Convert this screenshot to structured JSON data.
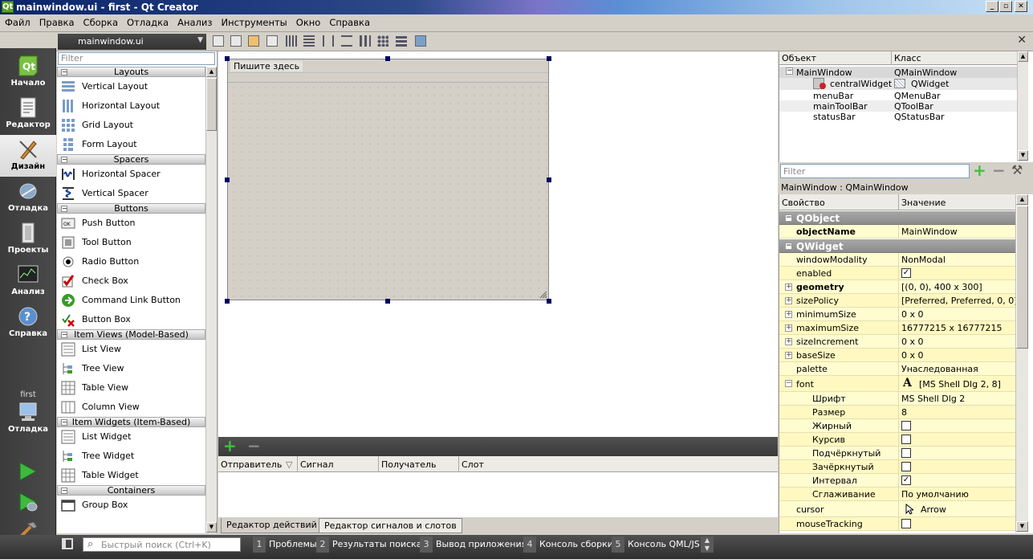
{
  "window": {
    "title": "mainwindow.ui - first - Qt Creator"
  },
  "menu": [
    "Файл",
    "Правка",
    "Сборка",
    "Отладка",
    "Анализ",
    "Инструменты",
    "Окно",
    "Справка"
  ],
  "modes": [
    {
      "label": "Начало",
      "icon": "qt-logo-icon"
    },
    {
      "label": "Редактор",
      "icon": "editor-icon"
    },
    {
      "label": "Дизайн",
      "icon": "design-icon"
    },
    {
      "label": "Отладка",
      "icon": "debug-icon"
    },
    {
      "label": "Проекты",
      "icon": "projects-icon"
    },
    {
      "label": "Анализ",
      "icon": "analyze-icon"
    },
    {
      "label": "Справка",
      "icon": "help-icon"
    }
  ],
  "target": {
    "project": "first",
    "label": "Отладка"
  },
  "editor": {
    "file": "mainwindow.ui"
  },
  "widgetbox": {
    "filter_placeholder": "Filter",
    "categories": [
      {
        "name": "Layouts",
        "items": [
          "Vertical Layout",
          "Horizontal Layout",
          "Grid Layout",
          "Form Layout"
        ]
      },
      {
        "name": "Spacers",
        "items": [
          "Horizontal Spacer",
          "Vertical Spacer"
        ]
      },
      {
        "name": "Buttons",
        "items": [
          "Push Button",
          "Tool Button",
          "Radio Button",
          "Check Box",
          "Command Link Button",
          "Button Box"
        ]
      },
      {
        "name": "Item Views (Model-Based)",
        "items": [
          "List View",
          "Tree View",
          "Table View",
          "Column View"
        ]
      },
      {
        "name": "Item Widgets (Item-Based)",
        "items": [
          "List Widget",
          "Tree Widget",
          "Table Widget"
        ]
      },
      {
        "name": "Containers",
        "items": [
          "Group Box"
        ]
      }
    ]
  },
  "form": {
    "menu_placeholder": "Пишите здесь"
  },
  "signals": {
    "columns": [
      "Отправитель",
      "Сигнал",
      "Получатель",
      "Слот"
    ],
    "tabs": [
      "Редактор действий",
      "Редактор сигналов и слотов"
    ]
  },
  "object_inspector": {
    "columns": [
      "Объект",
      "Класс"
    ],
    "rows": [
      {
        "object": "MainWindow",
        "class": "QMainWindow"
      },
      {
        "object": "centralWidget",
        "class": "QWidget"
      },
      {
        "object": "menuBar",
        "class": "QMenuBar"
      },
      {
        "object": "mainToolBar",
        "class": "QToolBar"
      },
      {
        "object": "statusBar",
        "class": "QStatusBar"
      }
    ]
  },
  "property_editor": {
    "filter_placeholder": "Filter",
    "class_label": "MainWindow : QMainWindow",
    "columns": [
      "Свойство",
      "Значение"
    ],
    "groups": {
      "qobject": "QObject",
      "qwidget": "QWidget"
    },
    "props": {
      "objectName": {
        "name": "objectName",
        "value": "MainWindow"
      },
      "windowModality": {
        "name": "windowModality",
        "value": "NonModal"
      },
      "enabled": {
        "name": "enabled",
        "checked": true
      },
      "geometry": {
        "name": "geometry",
        "value": "[(0, 0), 400 x 300]"
      },
      "sizePolicy": {
        "name": "sizePolicy",
        "value": "[Preferred, Preferred, 0, 0]"
      },
      "minimumSize": {
        "name": "minimumSize",
        "value": "0 x 0"
      },
      "maximumSize": {
        "name": "maximumSize",
        "value": "16777215 x 16777215"
      },
      "sizeIncrement": {
        "name": "sizeIncrement",
        "value": "0 x 0"
      },
      "baseSize": {
        "name": "baseSize",
        "value": "0 x 0"
      },
      "palette": {
        "name": "palette",
        "value": "Унаследованная"
      },
      "font": {
        "name": "font",
        "value": "[MS Shell Dlg 2, 8]"
      },
      "family": {
        "name": "Шрифт",
        "value": "MS Shell Dlg 2"
      },
      "size": {
        "name": "Размер",
        "value": "8"
      },
      "bold": {
        "name": "Жирный",
        "checked": false
      },
      "italic": {
        "name": "Курсив",
        "checked": false
      },
      "underline": {
        "name": "Подчёркнутый",
        "checked": false
      },
      "strikeout": {
        "name": "Зачёркнутый",
        "checked": false
      },
      "kerning": {
        "name": "Интервал",
        "checked": true
      },
      "antialiasing": {
        "name": "Сглаживание",
        "value": "По умолчанию"
      },
      "cursor": {
        "name": "cursor",
        "value": "Arrow"
      },
      "mouseTracking": {
        "name": "mouseTracking",
        "checked": false
      }
    }
  },
  "statusbar": {
    "search_placeholder": "Быстрый поиск (Ctrl+K)",
    "tabs": [
      {
        "num": "1",
        "label": "Проблемы"
      },
      {
        "num": "2",
        "label": "Результаты поиска"
      },
      {
        "num": "3",
        "label": "Вывод приложения"
      },
      {
        "num": "4",
        "label": "Консоль сборки"
      },
      {
        "num": "5",
        "label": "Консоль QML/JS"
      }
    ]
  }
}
